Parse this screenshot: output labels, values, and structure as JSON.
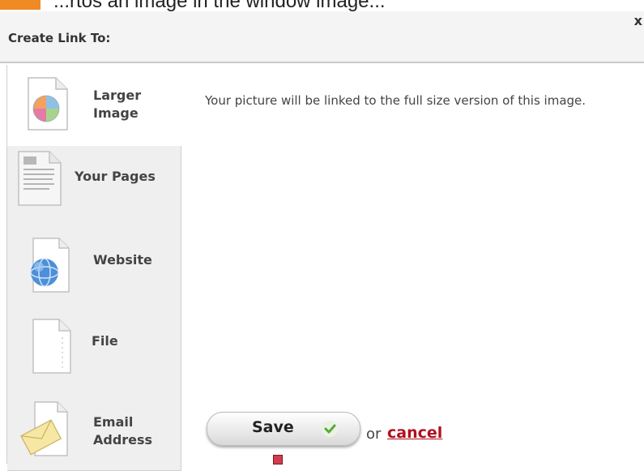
{
  "header": {
    "title": "Create Link To:",
    "close_label": "x"
  },
  "top_strip": {
    "cut_text": "...rtos an image in the window image..."
  },
  "tabs": [
    {
      "label_line1": "Larger",
      "label_line2": "Image",
      "icon": "image-file-icon",
      "active": true
    },
    {
      "label_line1": "Your Pages",
      "label_line2": "",
      "icon": "page-document-icon",
      "active": false
    },
    {
      "label_line1": "Website",
      "label_line2": "",
      "icon": "globe-file-icon",
      "active": false
    },
    {
      "label_line1": "File",
      "label_line2": "",
      "icon": "blank-file-icon",
      "active": false
    },
    {
      "label_line1": "Email",
      "label_line2": "Address",
      "icon": "envelope-icon",
      "active": false
    }
  ],
  "main": {
    "description": "Your picture will be linked to the full size version of this image.",
    "save_label": "Save",
    "or_label": "or",
    "cancel_label": "cancel"
  },
  "colors": {
    "accent_orange": "#f08a24",
    "cancel_red": "#b10f1f",
    "check_green": "#5aa83c"
  }
}
